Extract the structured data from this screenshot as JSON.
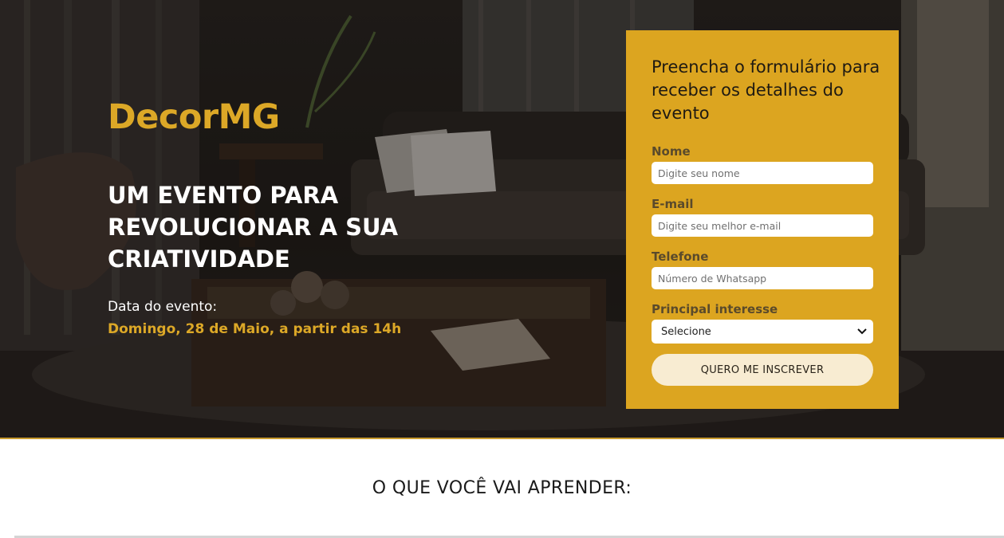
{
  "hero": {
    "brand": "DecorMG",
    "headline": "UM EVENTO PARA REVOLUCIONAR A SUA CRIATIVIDADE",
    "date_label": "Data do evento:",
    "date_value": "Domingo, 28 de Maio, a partir das 14h"
  },
  "form": {
    "title": "Preencha o formulário para receber os detalhes do evento",
    "name_label": "Nome",
    "name_placeholder": "Digite seu nome",
    "email_label": "E-mail",
    "email_placeholder": "Digite seu melhor e-mail",
    "phone_label": "Telefone",
    "phone_placeholder": "Número de Whatsapp",
    "interest_label": "Principal interesse",
    "interest_selected": "Selecione",
    "submit_label": "QUERO ME INSCREVER"
  },
  "section": {
    "title": "O QUE VOCÊ VAI APRENDER:"
  },
  "colors": {
    "accent": "#dca520",
    "brand_text": "#dca827",
    "button_bg": "#f8ecd2"
  },
  "icons": {
    "select_arrow": "chevron-down-icon"
  }
}
